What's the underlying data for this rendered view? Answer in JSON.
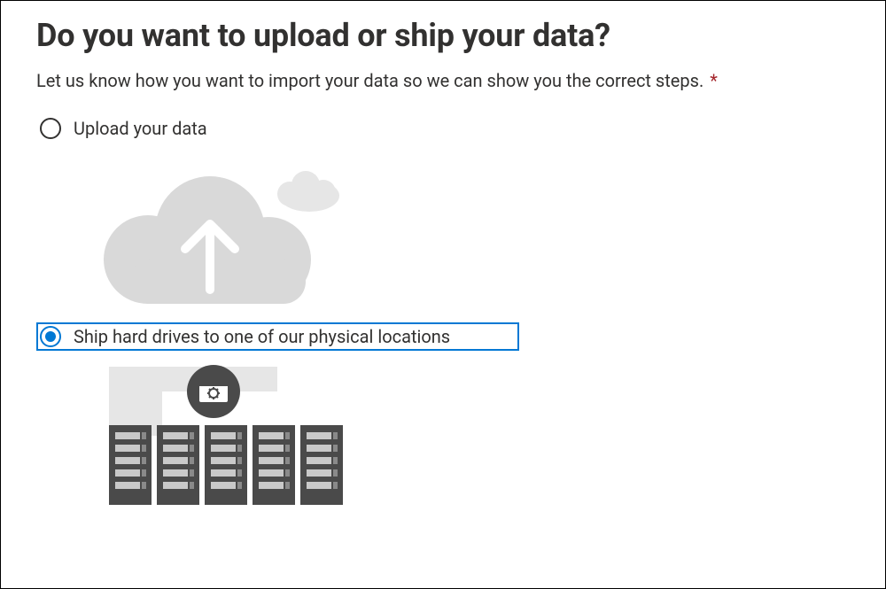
{
  "heading": "Do you want to upload or ship your data?",
  "intro": "Let us know how you want to import your data so we can show you the correct steps.",
  "required_mark": "*",
  "options": {
    "upload": {
      "label": "Upload your data",
      "selected": false,
      "illustration": "cloud-upload-icon"
    },
    "ship": {
      "label": "Ship hard drives to one of our physical locations",
      "selected": true,
      "illustration": "datacenter-icon"
    }
  },
  "colors": {
    "accent": "#0078d4",
    "text": "#323130",
    "muted": "#d9d9d9",
    "muted2": "#e6e6e6",
    "dark": "#4a4a4a"
  }
}
